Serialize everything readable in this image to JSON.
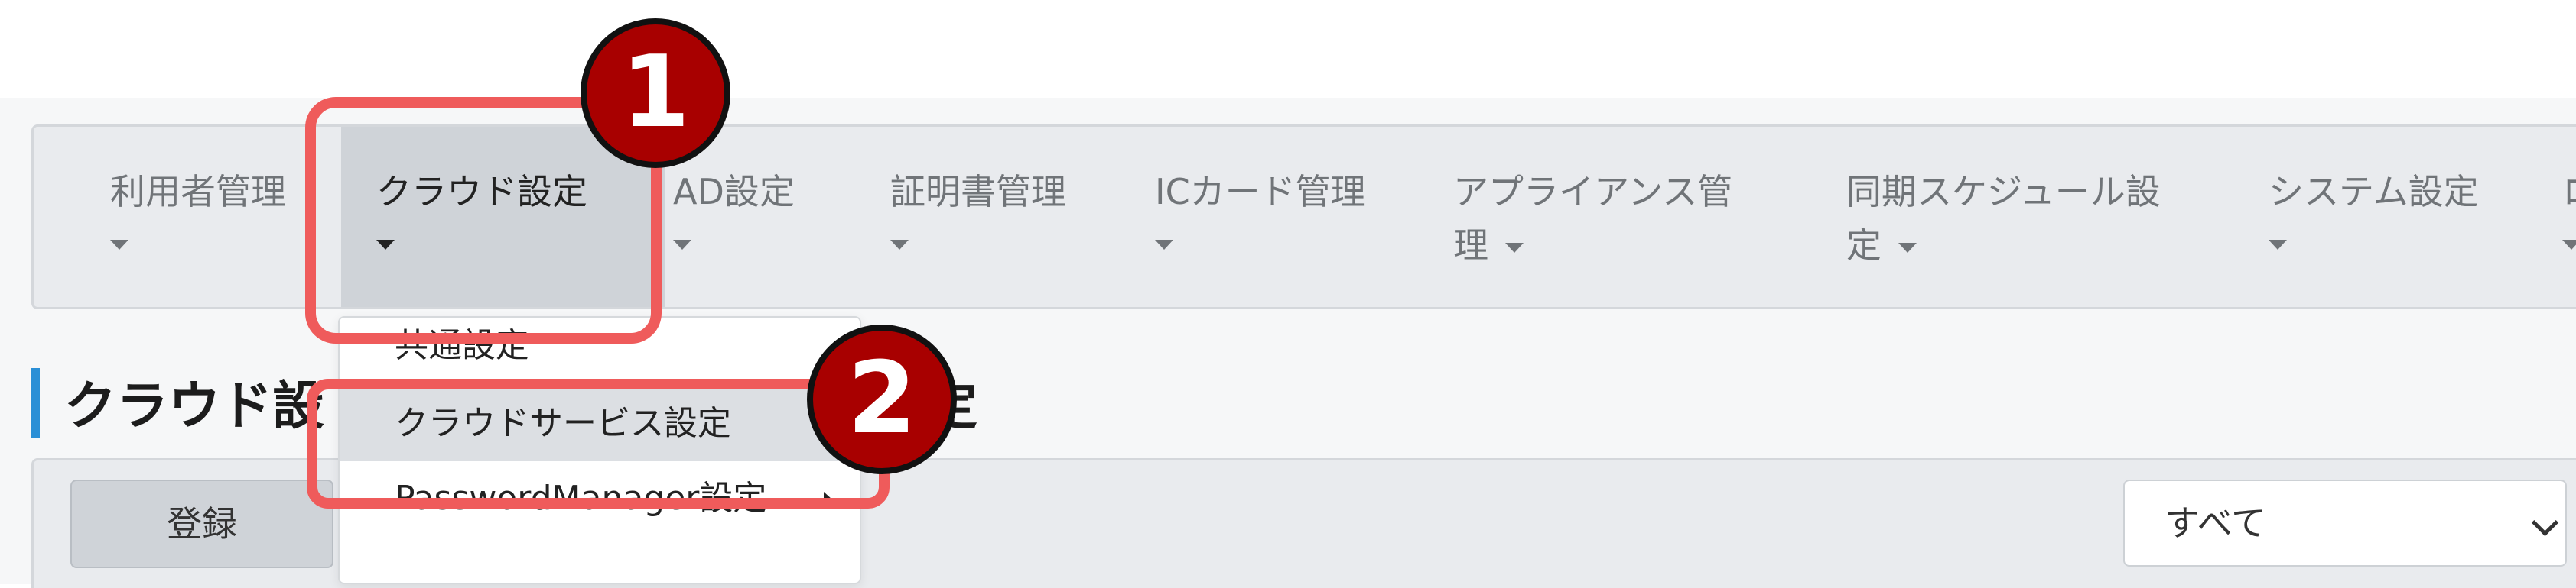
{
  "nav": {
    "items": [
      {
        "label": "利用者管理"
      },
      {
        "label": "クラウド設定",
        "active": true
      },
      {
        "label": "AD設定"
      },
      {
        "label": "証明書管理"
      },
      {
        "label": "ICカード管理"
      },
      {
        "label_line1": "アプライアンス管",
        "label_line2": "理"
      },
      {
        "label_line1": "同期スケジュール設",
        "label_line2": "定"
      },
      {
        "label": "システム設定"
      },
      {
        "label": "ロ"
      }
    ]
  },
  "dropdown": {
    "items": [
      {
        "label": "共通設定"
      },
      {
        "label": "クラウドサービス設定",
        "highlighted": true
      },
      {
        "label": "PasswordManager設定",
        "has_submenu": true
      }
    ]
  },
  "page": {
    "title_visible": "クラウド設",
    "title_tail": "定"
  },
  "toolbar": {
    "register_label": "登録",
    "filter_value": "すべて"
  },
  "annotations": {
    "step1": "1",
    "step2": "2",
    "highlight_color": "#ef5b5b",
    "badge_color": "#a80000"
  },
  "colors": {
    "accent_bar": "#2a8fd6",
    "navbar_bg": "#e9ebee",
    "active_bg": "#cfd3d8"
  }
}
